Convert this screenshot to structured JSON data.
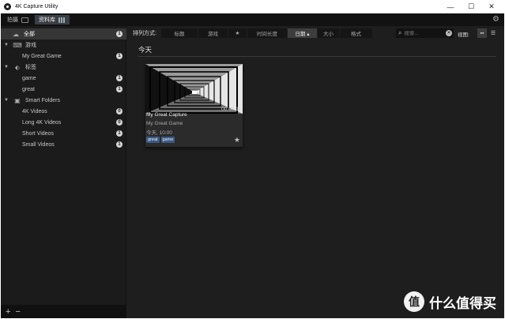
{
  "window": {
    "title": "4K Capture Utility"
  },
  "tabs": [
    {
      "label": "拍摄"
    },
    {
      "label": "资料库"
    }
  ],
  "sidebar": {
    "all": {
      "label": "全部",
      "count": "1"
    },
    "games": {
      "label": "游戏",
      "items": [
        {
          "label": "My Great Game",
          "count": "1"
        }
      ]
    },
    "tags": {
      "label": "标签",
      "items": [
        {
          "label": "game",
          "count": "1"
        },
        {
          "label": "great",
          "count": "1"
        }
      ]
    },
    "smart_folders": {
      "label": "Smart Folders",
      "items": [
        {
          "label": "4K Videos",
          "count": "0"
        },
        {
          "label": "Long 4K Videos",
          "count": "0"
        },
        {
          "label": "Short Videos",
          "count": "1"
        },
        {
          "label": "Small Videos",
          "count": "1"
        }
      ]
    },
    "add_label": "+",
    "remove_label": "−"
  },
  "toolbar": {
    "sort_label": "排列方式:",
    "sort_options": [
      {
        "label": "标题"
      },
      {
        "label": "游戏"
      },
      {
        "label": "★"
      },
      {
        "label": "时间长度"
      },
      {
        "label": "日期 ▴"
      },
      {
        "label": "大小"
      },
      {
        "label": "格式"
      }
    ],
    "sort_active_index": 4,
    "search_placeholder": "搜索...",
    "view_label": "视图:"
  },
  "library": {
    "section_title": "今天",
    "cards": [
      {
        "title": "My Great Capture",
        "duration": "00:00:11",
        "game": "My Great Game",
        "date": "今天, 10:00",
        "tags": [
          "great",
          "game"
        ]
      }
    ]
  },
  "watermark": {
    "logo": "值",
    "text": "什么值得买"
  },
  "icons": {
    "app": "app-logo-icon",
    "gear": "gear-icon",
    "search": "search-icon",
    "clear": "clear-icon",
    "star": "star-icon",
    "grid_view": "grid-view-icon",
    "list_view": "list-view-icon"
  }
}
